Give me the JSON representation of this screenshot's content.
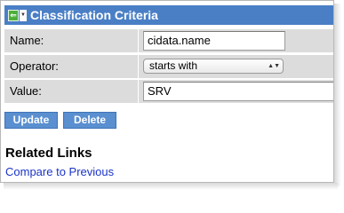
{
  "panel": {
    "title": "Classification Criteria",
    "back_icon_glyph": "⇐",
    "menu_icon_glyph": "▼"
  },
  "form": {
    "name": {
      "label": "Name:",
      "value": "cidata.name"
    },
    "operator": {
      "label": "Operator:",
      "selected": "starts with",
      "arrows_glyph": "▲▼"
    },
    "value": {
      "label": "Value:",
      "value": "SRV"
    }
  },
  "buttons": {
    "update_label": "Update",
    "delete_label": "Delete"
  },
  "related": {
    "title": "Related Links",
    "links": [
      "Compare to Previous"
    ]
  },
  "colors": {
    "header": "#4a7fc6",
    "button": "#5a8fd0",
    "link": "#1a33c8",
    "label_bg": "#dcdcdc"
  }
}
